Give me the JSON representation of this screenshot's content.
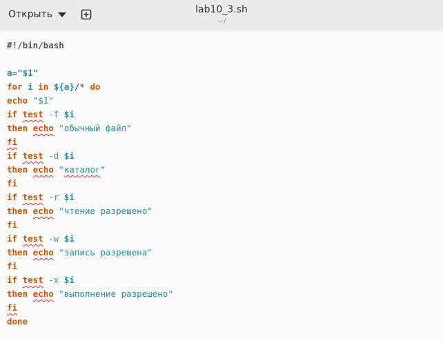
{
  "header": {
    "open_label": "Открыть",
    "open_icon": "chevron-down-icon",
    "new_tab_icon": "plus-box-icon",
    "title": "lab10_3.sh",
    "subtitle": "~/"
  },
  "colors": {
    "keyword": "#c35509",
    "variable": "#2a8a9a",
    "string": "#2a8a9a",
    "option": "#4c8fa8",
    "comment": "#555555",
    "spell_error": "#e03030"
  },
  "code": {
    "lines": [
      [
        {
          "t": "#!/bin/bash",
          "c": "comment"
        }
      ],
      [],
      [
        {
          "t": "a",
          "c": "var"
        },
        {
          "t": "=",
          "c": "plain"
        },
        {
          "t": "\"$1\"",
          "c": "var"
        }
      ],
      [
        {
          "t": "for",
          "c": "kw"
        },
        {
          "t": " ",
          "c": "plain"
        },
        {
          "t": "i",
          "c": "var"
        },
        {
          "t": " ",
          "c": "plain"
        },
        {
          "t": "in",
          "c": "kw"
        },
        {
          "t": " ",
          "c": "plain"
        },
        {
          "t": "${a}",
          "c": "var"
        },
        {
          "t": "/* ",
          "c": "plain"
        },
        {
          "t": "do",
          "c": "kw"
        }
      ],
      [
        {
          "t": "echo",
          "c": "kw"
        },
        {
          "t": " ",
          "c": "plain"
        },
        {
          "t": "\"$1\"",
          "c": "str"
        }
      ],
      [
        {
          "t": "if",
          "c": "kw"
        },
        {
          "t": " ",
          "c": "plain"
        },
        {
          "t": "test",
          "c": "kw",
          "e": true
        },
        {
          "t": " ",
          "c": "plain"
        },
        {
          "t": "-f",
          "c": "opt"
        },
        {
          "t": " ",
          "c": "plain"
        },
        {
          "t": "$i",
          "c": "var"
        }
      ],
      [
        {
          "t": "then",
          "c": "kw"
        },
        {
          "t": " ",
          "c": "plain"
        },
        {
          "t": "echo",
          "c": "kw",
          "e": true
        },
        {
          "t": " ",
          "c": "plain"
        },
        {
          "t": "\"обычный файл\"",
          "c": "str"
        }
      ],
      [
        {
          "t": "fi",
          "c": "kw",
          "e": true
        }
      ],
      [
        {
          "t": "if",
          "c": "kw"
        },
        {
          "t": " ",
          "c": "plain"
        },
        {
          "t": "test",
          "c": "kw",
          "e": true
        },
        {
          "t": " ",
          "c": "plain"
        },
        {
          "t": "-d",
          "c": "opt"
        },
        {
          "t": " ",
          "c": "plain"
        },
        {
          "t": "$i",
          "c": "var"
        }
      ],
      [
        {
          "t": "then",
          "c": "kw"
        },
        {
          "t": " ",
          "c": "plain"
        },
        {
          "t": "echo",
          "c": "kw",
          "e": true
        },
        {
          "t": " ",
          "c": "plain"
        },
        {
          "t": "\"",
          "c": "str"
        },
        {
          "t": "каталог",
          "c": "str",
          "e": true
        },
        {
          "t": "\"",
          "c": "str"
        }
      ],
      [
        {
          "t": "fi",
          "c": "kw"
        }
      ],
      [
        {
          "t": "if",
          "c": "kw"
        },
        {
          "t": " ",
          "c": "plain"
        },
        {
          "t": "test",
          "c": "kw",
          "e": true
        },
        {
          "t": " ",
          "c": "plain"
        },
        {
          "t": "-r",
          "c": "opt"
        },
        {
          "t": " ",
          "c": "plain"
        },
        {
          "t": "$i",
          "c": "var"
        }
      ],
      [
        {
          "t": "then",
          "c": "kw"
        },
        {
          "t": " ",
          "c": "plain"
        },
        {
          "t": "echo",
          "c": "kw",
          "e": true
        },
        {
          "t": " ",
          "c": "plain"
        },
        {
          "t": "\"чтение разрешено\"",
          "c": "str"
        }
      ],
      [
        {
          "t": "fi",
          "c": "kw"
        }
      ],
      [
        {
          "t": "if",
          "c": "kw"
        },
        {
          "t": " ",
          "c": "plain"
        },
        {
          "t": "test",
          "c": "kw",
          "e": true
        },
        {
          "t": " ",
          "c": "plain"
        },
        {
          "t": "-w",
          "c": "opt"
        },
        {
          "t": " ",
          "c": "plain"
        },
        {
          "t": "$i",
          "c": "var"
        }
      ],
      [
        {
          "t": "then",
          "c": "kw"
        },
        {
          "t": " ",
          "c": "plain"
        },
        {
          "t": "echo",
          "c": "kw",
          "e": true
        },
        {
          "t": " ",
          "c": "plain"
        },
        {
          "t": "\"запись разрешена\"",
          "c": "str"
        }
      ],
      [
        {
          "t": "fi",
          "c": "kw"
        }
      ],
      [
        {
          "t": "if",
          "c": "kw"
        },
        {
          "t": " ",
          "c": "plain"
        },
        {
          "t": "test",
          "c": "kw",
          "e": true
        },
        {
          "t": " ",
          "c": "plain"
        },
        {
          "t": "-x",
          "c": "opt"
        },
        {
          "t": " ",
          "c": "plain"
        },
        {
          "t": "$i",
          "c": "var"
        }
      ],
      [
        {
          "t": "then",
          "c": "kw"
        },
        {
          "t": " ",
          "c": "plain"
        },
        {
          "t": "echo",
          "c": "kw",
          "e": true
        },
        {
          "t": " ",
          "c": "plain"
        },
        {
          "t": "\"выполнение разрешено\"",
          "c": "str"
        }
      ],
      [
        {
          "t": "fi",
          "c": "kw",
          "e": true
        }
      ],
      [
        {
          "t": "done",
          "c": "kw"
        }
      ]
    ]
  }
}
